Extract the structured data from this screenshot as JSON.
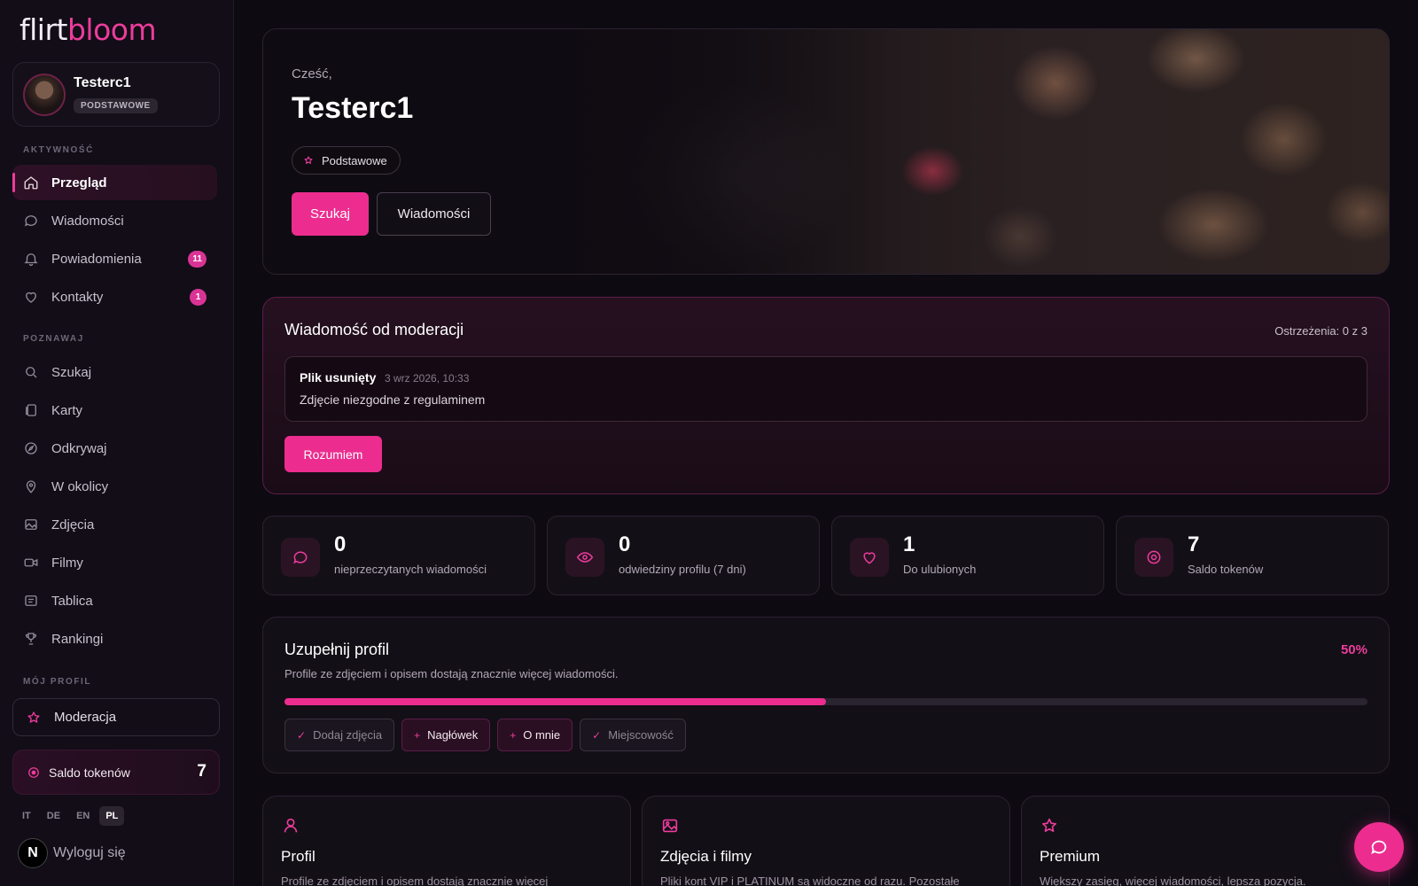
{
  "brand": {
    "part1": "flirt",
    "part2": "bloom",
    "accent": "#ec2d8f"
  },
  "user": {
    "name": "Testerc1",
    "plan": "PODSTAWOWE"
  },
  "sidebar": {
    "activity_label": "AKTYWNOŚĆ",
    "activity_items": [
      {
        "label": "Przegląd",
        "icon": "home-icon",
        "active": true
      },
      {
        "label": "Wiadomości",
        "icon": "chat-bubble-icon"
      },
      {
        "label": "Powiadomienia",
        "icon": "bell-icon",
        "badge": "11"
      },
      {
        "label": "Kontakty",
        "icon": "heart-icon",
        "badge": "1"
      }
    ],
    "discover_label": "POZNAWAJ",
    "discover_items": [
      {
        "label": "Szukaj",
        "icon": "search-icon"
      },
      {
        "label": "Karty",
        "icon": "cards-icon"
      },
      {
        "label": "Odkrywaj",
        "icon": "compass-icon"
      },
      {
        "label": "W okolicy",
        "icon": "map-pin-icon"
      },
      {
        "label": "Zdjęcia",
        "icon": "image-icon"
      },
      {
        "label": "Filmy",
        "icon": "video-icon"
      },
      {
        "label": "Tablica",
        "icon": "board-icon"
      },
      {
        "label": "Rankingi",
        "icon": "trophy-icon"
      }
    ],
    "profile_label": "MÓJ PROFIL",
    "moderation_item": "Moderacja",
    "tokens_label": "Saldo tokenów",
    "tokens_value": "7",
    "languages": [
      "IT",
      "DE",
      "EN",
      "PL"
    ],
    "active_language": "PL",
    "logout": "Wyloguj się"
  },
  "hero": {
    "greeting": "Cześć,",
    "name": "Testerc1",
    "plan_chip": "Podstawowe",
    "search_button": "Szukaj",
    "messages_button": "Wiadomości"
  },
  "moderation": {
    "title": "Wiadomość od moderacji",
    "warnings": "Ostrzeżenia: 0 z 3",
    "message_title": "Plik usunięty",
    "message_date": "3 wrz 2026, 10:33",
    "message_body": "Zdjęcie niezgodne z regulaminem",
    "ack_button": "Rozumiem"
  },
  "stats": [
    {
      "value": "0",
      "label": "nieprzeczytanych wiadomości",
      "icon": "chat-bubble-icon"
    },
    {
      "value": "0",
      "label": "odwiedziny profilu (7 dni)",
      "icon": "eye-icon"
    },
    {
      "value": "1",
      "label": "Do ulubionych",
      "icon": "heart-icon"
    },
    {
      "value": "7",
      "label": "Saldo tokenów",
      "icon": "coin-icon"
    }
  ],
  "completion": {
    "title": "Uzupełnij profil",
    "percent_label": "50%",
    "progress_fraction": 0.5,
    "subtitle": "Profile ze zdjęciem i opisem dostają znacznie więcej wiadomości.",
    "chips": [
      {
        "label": "Dodaj zdjęcia",
        "done": true
      },
      {
        "label": "Nagłówek",
        "done": false
      },
      {
        "label": "O mnie",
        "done": false
      },
      {
        "label": "Miejscowość",
        "done": true
      }
    ]
  },
  "features": [
    {
      "title": "Profil",
      "desc": "Profile ze zdjęciem i opisem dostają znacznie więcej",
      "icon": "user-icon"
    },
    {
      "title": "Zdjęcia i filmy",
      "desc": "Pliki kont VIP i PLATINUM są widoczne od razu. Pozostałe",
      "icon": "image-icon"
    },
    {
      "title": "Premium",
      "desc": "Większy zasięg, więcej wiadomości, lepsza pozycja.",
      "icon": "star-icon"
    }
  ]
}
